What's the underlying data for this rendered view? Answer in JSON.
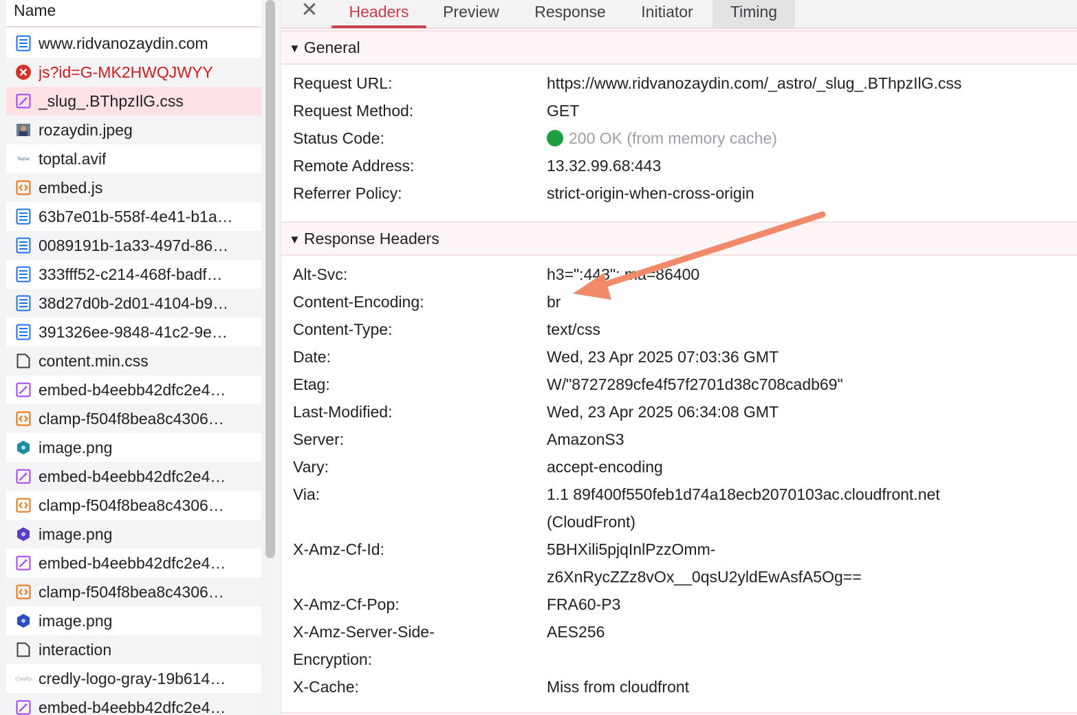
{
  "request_list": {
    "header": "Name",
    "items": [
      {
        "name": "www.ridvanozaydin.com",
        "icon": "document-icon",
        "state": "normal"
      },
      {
        "name": "js?id=G-MK2HWQJWYY",
        "icon": "error-icon",
        "state": "error"
      },
      {
        "name": "_slug_.BThpzIlG.css",
        "icon": "stylesheet-icon",
        "state": "selected"
      },
      {
        "name": "rozaydin.jpeg",
        "icon": "image-thumbnail-icon",
        "state": "normal"
      },
      {
        "name": "toptal.avif",
        "icon": "toptal-logo-icon",
        "state": "normal"
      },
      {
        "name": "embed.js",
        "icon": "script-icon",
        "state": "normal"
      },
      {
        "name": "63b7e01b-558f-4e41-b1a…",
        "icon": "document-icon",
        "state": "normal"
      },
      {
        "name": "0089191b-1a33-497d-86…",
        "icon": "document-icon",
        "state": "normal"
      },
      {
        "name": "333fff52-c214-468f-badf…",
        "icon": "document-icon",
        "state": "normal"
      },
      {
        "name": "38d27d0b-2d01-4104-b9…",
        "icon": "document-icon",
        "state": "normal"
      },
      {
        "name": "391326ee-9848-41c2-9e…",
        "icon": "document-icon",
        "state": "normal"
      },
      {
        "name": "content.min.css",
        "icon": "file-icon",
        "state": "normal"
      },
      {
        "name": "embed-b4eebb42dfc2e4…",
        "icon": "stylesheet-icon",
        "state": "normal"
      },
      {
        "name": "clamp-f504f8bea8c4306…",
        "icon": "script-icon",
        "state": "normal"
      },
      {
        "name": "image.png",
        "icon": "badge-teal-icon",
        "state": "normal"
      },
      {
        "name": "embed-b4eebb42dfc2e4…",
        "icon": "stylesheet-icon",
        "state": "normal"
      },
      {
        "name": "clamp-f504f8bea8c4306…",
        "icon": "script-icon",
        "state": "normal"
      },
      {
        "name": "image.png",
        "icon": "badge-purple-icon",
        "state": "normal"
      },
      {
        "name": "embed-b4eebb42dfc2e4…",
        "icon": "stylesheet-icon",
        "state": "normal"
      },
      {
        "name": "clamp-f504f8bea8c4306…",
        "icon": "script-icon",
        "state": "normal"
      },
      {
        "name": "image.png",
        "icon": "badge-blue-icon",
        "state": "normal"
      },
      {
        "name": "interaction",
        "icon": "file-icon",
        "state": "normal"
      },
      {
        "name": "credly-logo-gray-19b614…",
        "icon": "credly-logo-icon",
        "state": "normal"
      },
      {
        "name": "embed-b4eebb42dfc2e4…",
        "icon": "stylesheet-icon",
        "state": "normal"
      }
    ]
  },
  "tabs": {
    "close_icon": "close-icon",
    "headers": "Headers",
    "preview": "Preview",
    "response": "Response",
    "initiator": "Initiator",
    "timing": "Timing",
    "active": "Headers"
  },
  "general": {
    "title": "General",
    "rows": [
      {
        "key": "Request URL:",
        "value": "https://www.ridvanozaydin.com/_astro/_slug_.BThpzIlG.css"
      },
      {
        "key": "Request Method:",
        "value": "GET"
      },
      {
        "key": "Status Code:",
        "value": "200 OK (from memory cache)"
      },
      {
        "key": "Remote Address:",
        "value": "13.32.99.68:443"
      },
      {
        "key": "Referrer Policy:",
        "value": "strict-origin-when-cross-origin"
      }
    ]
  },
  "response_headers": {
    "title": "Response Headers",
    "rows": [
      {
        "key": "Alt-Svc:",
        "value": "h3=\":443\"; ma=86400"
      },
      {
        "key": "Content-Encoding:",
        "value": "br"
      },
      {
        "key": "Content-Type:",
        "value": "text/css"
      },
      {
        "key": "Date:",
        "value": "Wed, 23 Apr 2025 07:03:36 GMT"
      },
      {
        "key": "Etag:",
        "value": "W/\"8727289cfe4f57f2701d38c708cadb69\""
      },
      {
        "key": "Last-Modified:",
        "value": "Wed, 23 Apr 2025 06:34:08 GMT"
      },
      {
        "key": "Server:",
        "value": "AmazonS3"
      },
      {
        "key": "Vary:",
        "value": "accept-encoding"
      },
      {
        "key": "Via:",
        "value": "1.1 89f400f550feb1d74a18ecb2070103ac.cloudfront.net",
        "value2": "(CloudFront)"
      },
      {
        "key": "X-Amz-Cf-Id:",
        "value": "5BHXili5pjqInlPzzOmm-",
        "value2": "z6XnRycZZz8vOx__0qsU2yldEwAsfA5Og=="
      },
      {
        "key": "X-Amz-Cf-Pop:",
        "value": "FRA60-P3"
      },
      {
        "key": "X-Amz-Server-Side-",
        "key2": "Encryption:",
        "value": "AES256"
      },
      {
        "key": "X-Cache:",
        "value": "Miss from cloudfront"
      }
    ]
  },
  "colors": {
    "accent": "#c93b4b",
    "selected_row": "#fde1e4",
    "error_text": "#d21a1a",
    "status_ok": "#1e9e3f",
    "annotation_arrow": "#f08a6b"
  }
}
